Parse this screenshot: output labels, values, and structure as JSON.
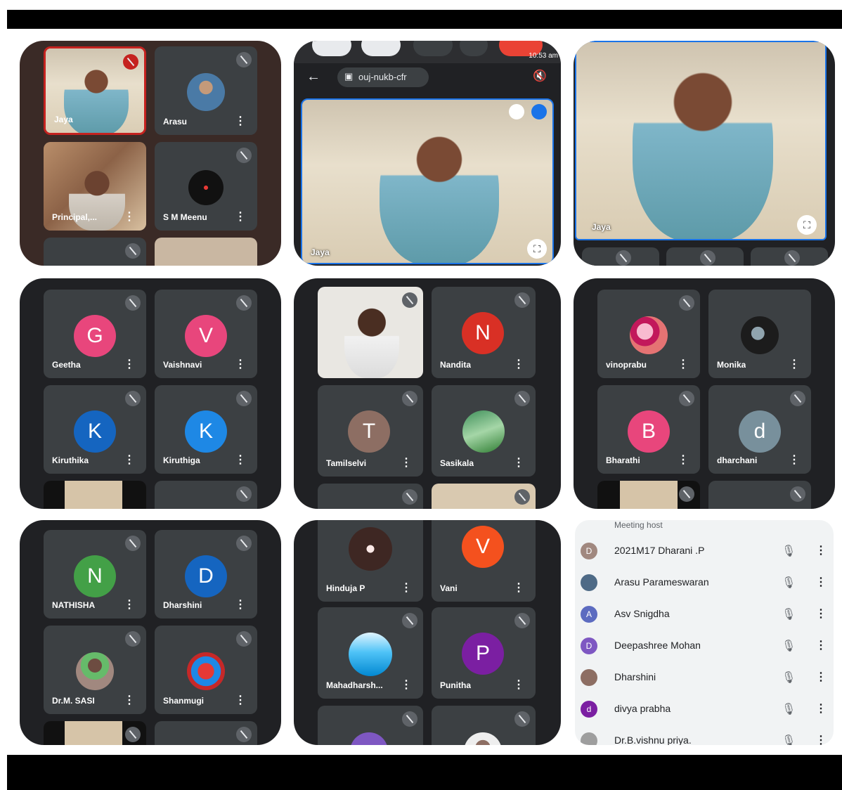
{
  "panel1": {
    "tiles": [
      {
        "name": "Jaya"
      },
      {
        "name": "Arasu"
      },
      {
        "name": "Principal,..."
      },
      {
        "name": "S M Meenu"
      }
    ]
  },
  "panel2": {
    "time": "10:53 am",
    "meeting_code": "ouj-nukb-cfr",
    "speaker_name": "Jaya"
  },
  "panel3": {
    "speaker_name": "Jaya"
  },
  "panel4": {
    "tiles": [
      {
        "initial": "G",
        "name": "Geetha",
        "color": "#e8467c"
      },
      {
        "initial": "V",
        "name": "Vaishnavi",
        "color": "#e8467c"
      },
      {
        "initial": "K",
        "name": "Kiruthika",
        "color": "#1a73e8"
      },
      {
        "initial": "K",
        "name": "Kiruthiga",
        "color": "#1e88e5"
      }
    ]
  },
  "panel5": {
    "tiles": [
      {
        "initial": "",
        "name": "",
        "color": ""
      },
      {
        "initial": "N",
        "name": "Nandita",
        "color": "#d93025"
      },
      {
        "initial": "T",
        "name": "Tamilselvi",
        "color": "#8d6e63"
      },
      {
        "initial": "",
        "name": "Sasikala",
        "color": "#3f8f5a"
      }
    ]
  },
  "panel6": {
    "tiles": [
      {
        "initial": "",
        "name": "vinoprabu",
        "color": "#c2185b"
      },
      {
        "initial": "",
        "name": "Monika",
        "color": "#1c1c1c"
      },
      {
        "initial": "B",
        "name": "Bharathi",
        "color": "#e8467c"
      },
      {
        "initial": "d",
        "name": "dharchani",
        "color": "#78909c"
      }
    ]
  },
  "panel7": {
    "tiles": [
      {
        "initial": "N",
        "name": "NATHISHA",
        "color": "#43a047"
      },
      {
        "initial": "D",
        "name": "Dharshini",
        "color": "#1a73e8"
      },
      {
        "initial": "",
        "name": "Dr.M. SASI",
        "color": "#5d4037"
      },
      {
        "initial": "",
        "name": "Shanmugi",
        "color": "#c62828"
      }
    ]
  },
  "panel8": {
    "tiles": [
      {
        "initial": "",
        "name": "Hinduja P",
        "color": "#3e2723"
      },
      {
        "initial": "V",
        "name": "Vani",
        "color": "#f4511e"
      },
      {
        "initial": "",
        "name": "Mahadharsh...",
        "color": "#0288d1"
      },
      {
        "initial": "P",
        "name": "Punitha",
        "color": "#7b1fa2"
      }
    ]
  },
  "participants": {
    "host_label": "Meeting host",
    "rows": [
      {
        "initial": "D",
        "name": "2021M17 Dharani .P",
        "color": "#a1887f"
      },
      {
        "initial": "",
        "name": "Arasu Parameswaran",
        "color": "#4e6a86"
      },
      {
        "initial": "A",
        "name": "Asv Snigdha",
        "color": "#5c6bc0"
      },
      {
        "initial": "D",
        "name": "Deepashree Mohan",
        "color": "#7e57c2"
      },
      {
        "initial": "",
        "name": "Dharshini",
        "color": "#8d6e63"
      },
      {
        "initial": "d",
        "name": "divya prabha",
        "color": "#7b1fa2"
      },
      {
        "initial": "",
        "name": "Dr.B.vishnu priya.",
        "color": "#9e9e9e"
      }
    ]
  }
}
